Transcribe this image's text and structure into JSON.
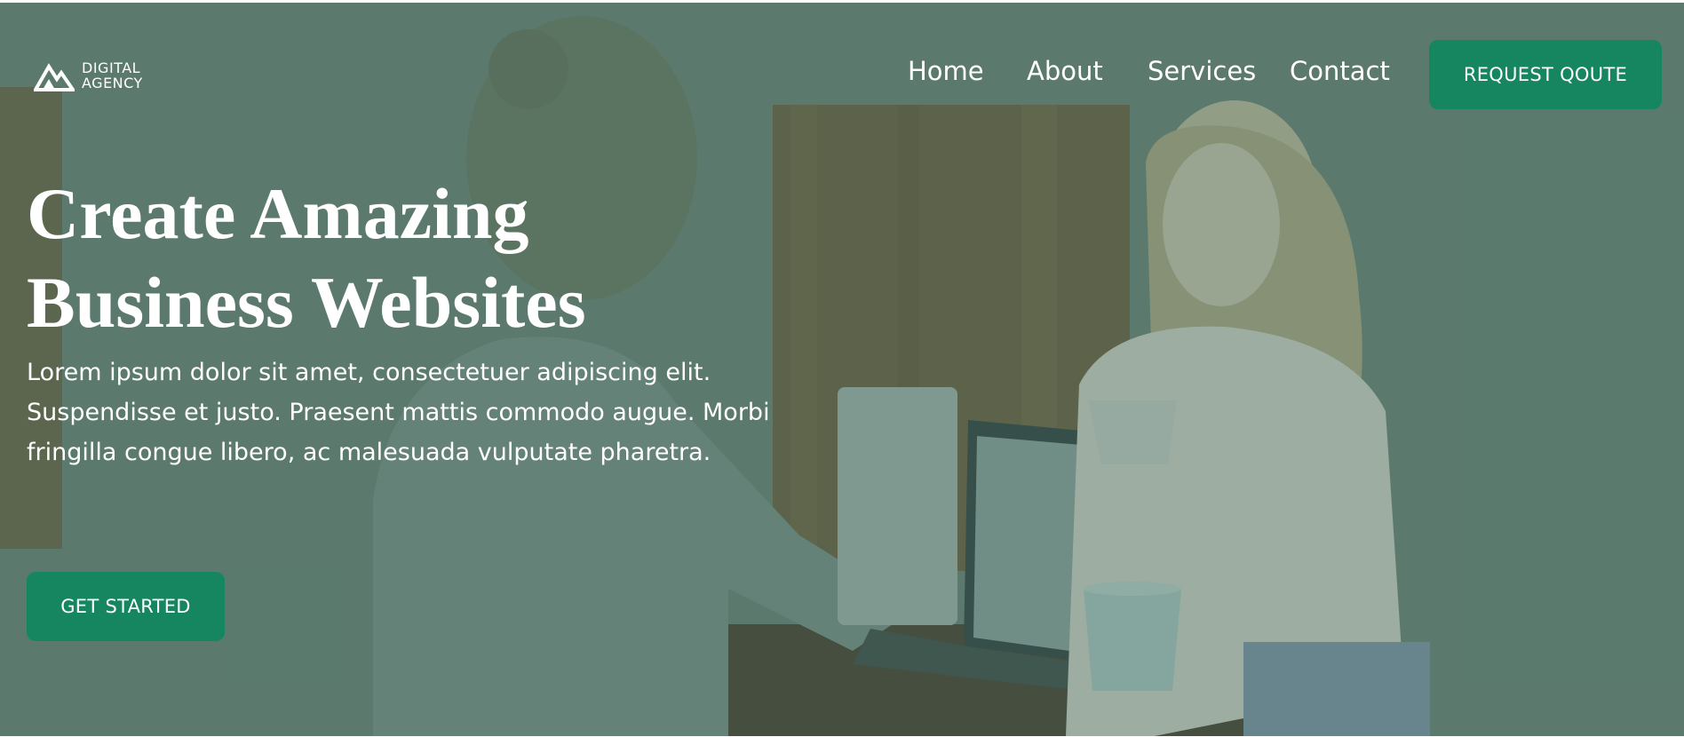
{
  "header": {
    "logo": {
      "line1": "DIGITAL",
      "line2": "AGENCY",
      "icon": "mountain-logo-icon"
    },
    "nav": [
      {
        "label": "Home"
      },
      {
        "label": "About"
      },
      {
        "label": "Services"
      },
      {
        "label": "Contact"
      }
    ],
    "cta_label": "REQUEST QOUTE"
  },
  "hero": {
    "title_line1": "Create Amazing",
    "title_line2": "Business Websites",
    "description": "Lorem ipsum dolor sit amet, consectetuer adipiscing elit. Suspendisse et justo. Praesent mattis commodo augue. Morbi fringilla congue libero, ac malesuada vulputate pharetra.",
    "button_label": "GET STARTED",
    "background_photo": "two people laughing at a laptop with coffee mugs"
  },
  "colors": {
    "accent": "#158660",
    "overlay_tint": "#4e7a6c",
    "text": "#ffffff"
  }
}
